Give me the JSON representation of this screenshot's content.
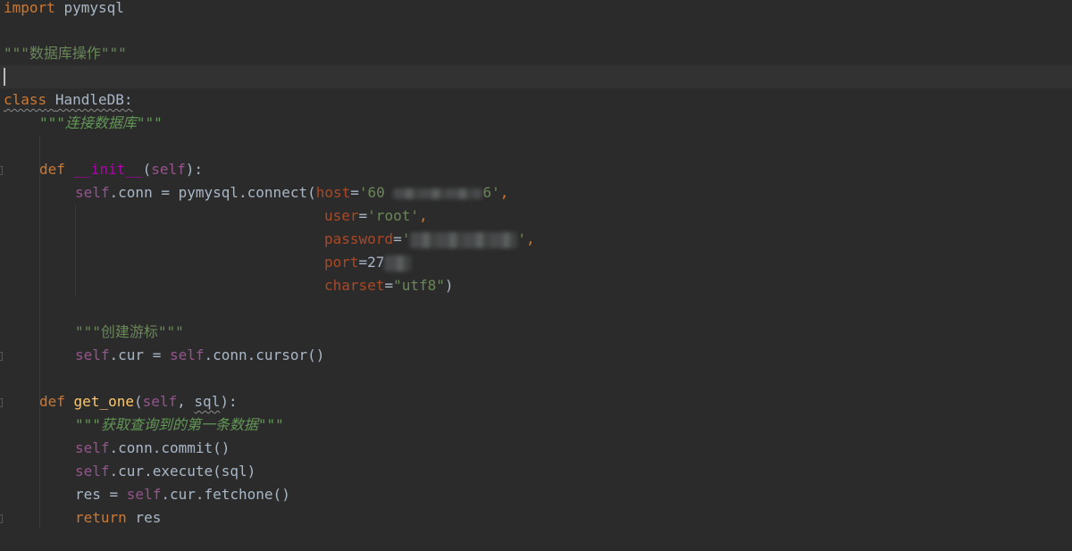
{
  "editor": {
    "language": "Python",
    "colors": {
      "background": "#2b2b2b",
      "current_line": "#323232",
      "keyword": "#cc7832",
      "self": "#94558d",
      "parameter": "#aa4926",
      "string": "#6a8759",
      "docstring": "#629755",
      "dunder": "#b200b2",
      "function": "#ffc66d",
      "default": "#a9b7c6"
    },
    "line1": {
      "kw": "import",
      "module": "pymysql"
    },
    "line3": {
      "doc": "\"\"\"数据库操作\"\"\""
    },
    "line5": {
      "kw": "class",
      "name": "HandleDB",
      "colon": ":"
    },
    "line6": {
      "doc": "\"\"\"连接数据库\"\"\""
    },
    "line8": {
      "kw": "def",
      "name": "__init__",
      "open": "(",
      "self": "self",
      "close": "):"
    },
    "line9": {
      "self": "self",
      "mid": ".conn = pymysql.connect(",
      "param": "host",
      "eq": "=",
      "str_a": "'60",
      "str_b": "6'",
      "comma": ","
    },
    "line10": {
      "param": "user",
      "eq": "=",
      "str": "'root'",
      "comma": ","
    },
    "line11": {
      "param": "password",
      "eq": "=",
      "str_a": "'",
      "str_b": "'",
      "comma": ","
    },
    "line12": {
      "param": "port",
      "eq": "=",
      "num": "27"
    },
    "line13": {
      "param": "charset",
      "eq": "=",
      "str": "\"utf8\"",
      "close": ")"
    },
    "line15": {
      "doc": "\"\"\"创建游标\"\"\""
    },
    "line16": {
      "self_a": "self",
      "mid": ".cur = ",
      "self_b": "self",
      "end": ".conn.cursor()"
    },
    "line18": {
      "kw": "def",
      "name": "get_one",
      "open": "(",
      "self": "self",
      "sep": ", ",
      "arg": "sql",
      "close": "):"
    },
    "line19": {
      "doc": "\"\"\"获取查询到的第一条数据\"\"\""
    },
    "line20": {
      "self": "self",
      "rest": ".conn.commit()"
    },
    "line21": {
      "self": "self",
      "rest": ".cur.execute(sql)"
    },
    "line22": {
      "pre": "res = ",
      "self": "self",
      "rest": ".cur.fetchone()"
    },
    "line23": {
      "kw": "return",
      "rest": " res"
    }
  }
}
